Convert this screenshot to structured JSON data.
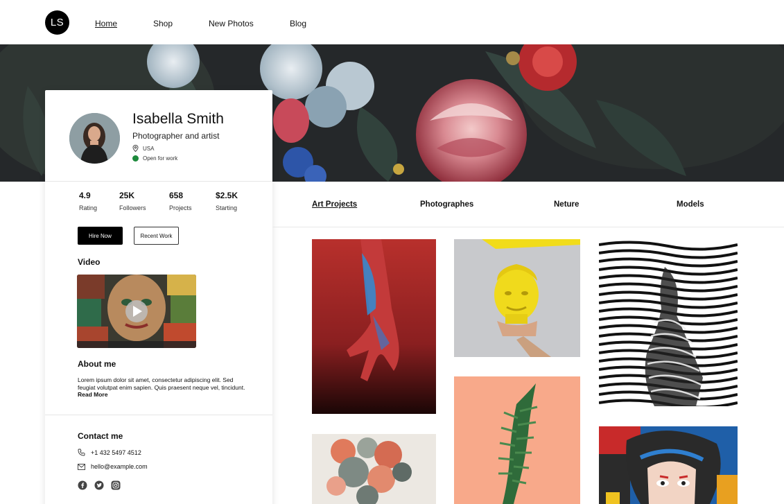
{
  "logo": {
    "text": "LS"
  },
  "nav": {
    "items": [
      "Home",
      "Shop",
      "New Photos",
      "Blog"
    ],
    "active": "Home"
  },
  "profile": {
    "name": "Isabella Smith",
    "title": "Photographer and artist",
    "location": "USA",
    "status": "Open for work",
    "status_color": "#1d8a3c"
  },
  "stats": [
    {
      "value": "4.9",
      "label": "Rating"
    },
    {
      "value": "25K",
      "label": "Followers"
    },
    {
      "value": "658",
      "label": "Projects"
    },
    {
      "value": "$2.5K",
      "label": "Starting"
    }
  ],
  "actions": {
    "hire": "Hire Now",
    "recent": "Recent Work"
  },
  "video": {
    "heading": "Video"
  },
  "about": {
    "heading": "About me",
    "text": "Lorem ipsum dolor sit amet, consectetur adipiscing elit. Sed feugiat volutpat enim sapien. Quis praesent neque vel, tincidunt.",
    "more": "Read More"
  },
  "contact": {
    "heading": "Contact me",
    "phone": "+1 432 5497 4512",
    "email": "hello@example.com",
    "socials": [
      "facebook-icon",
      "twitter-icon",
      "instagram-icon"
    ]
  },
  "tabs": {
    "items": [
      "Art Projects",
      "Photographes",
      "Neture",
      "Models"
    ],
    "active": "Art Projects"
  },
  "colors": {
    "accent": "#000000",
    "hero_bg": "#25282a"
  }
}
